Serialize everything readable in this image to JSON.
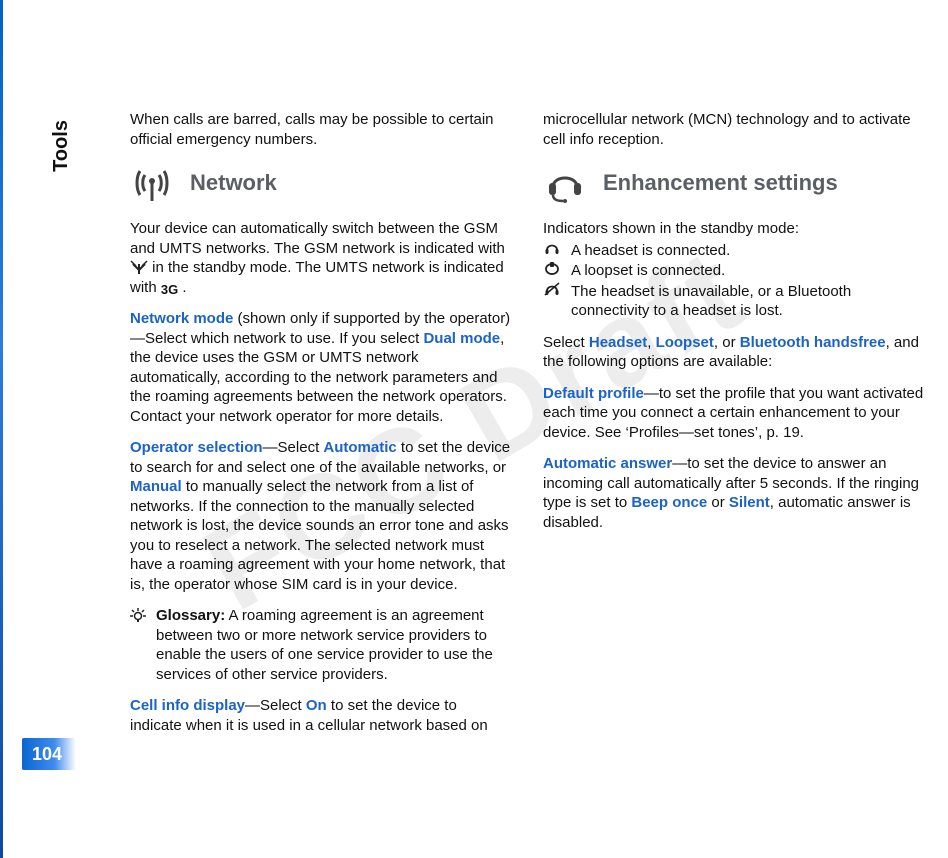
{
  "page": {
    "sectionTitle": "Tools",
    "number": "104",
    "watermark": "FCC Draft"
  },
  "col1": {
    "intro": "When calls are barred, calls may be possible to certain official emergency numbers.",
    "h_network": "Network",
    "network_body": "Your device can automatically switch between the GSM and UMTS networks. The GSM network is indicated with ",
    "network_body2": " in the standby mode. The UMTS network is indicated with ",
    "network_body3": ".",
    "nm_label": "Network mode",
    "nm_body1": " (shown only if supported by the operator)—Select which network to use. If you select ",
    "nm_dual": "Dual mode",
    "nm_body2": ", the device uses the GSM or UMTS network automatically, according to the network parameters and the roaming agreements between the network operators. Contact your network operator for more details.",
    "os_label": "Operator selection",
    "os_body1": "—Select ",
    "os_auto": "Automatic",
    "os_body2": " to set the device to search for and select one of the available networks, or ",
    "os_manual": "Manual",
    "os_body3": " to manually select the network from a list of networks. If the connection to the manually selected network is lost, the device sounds an error tone and asks you to reselect a network. The selected network must have a roaming agreement with your home network, that is, the operator whose SIM card is in your device.",
    "gloss_label": "Glossary:",
    "gloss_body": " A roaming agreement is an agreement between two or more network service providers to enable the users of one service provider to use the services of other service providers."
  },
  "col2": {
    "cid_label": "Cell info display",
    "cid_body1": "—Select ",
    "cid_on": "On",
    "cid_body2": " to set the device to indicate when it is used in a cellular network based on microcellular network (MCN) technology and to activate cell info reception.",
    "h_enh": "Enhancement settings",
    "ind_intro": "Indicators shown in the standby mode:",
    "ind_hs": " A headset is connected.",
    "ind_lp": " A loopset is connected.",
    "ind_bt": " The headset is unavailable, or a Bluetooth connectivity to a headset is lost.",
    "sel_body1": "Select ",
    "sel_hs": "Headset",
    "sel_body2": ", ",
    "sel_lp": "Loopset",
    "sel_body3": ", or ",
    "sel_bt": "Bluetooth handsfree",
    "sel_body4": ", and the following options are available:",
    "dp_label": "Default profile",
    "dp_body": "—to set the profile that you want activated each time you connect a certain enhancement to your device. See ‘Profiles—set tones’, p. 19.",
    "aa_label": "Automatic answer",
    "aa_body1": "—to set the device to answer an incoming call automatically after 5 seconds. If the ringing type is set to ",
    "aa_beep": "Beep once",
    "aa_body2": " or ",
    "aa_silent": "Silent",
    "aa_body3": ", automatic answer is disabled."
  },
  "icons": {
    "antenna": "antenna-icon",
    "signal": "signal-icon",
    "threeG": "3G",
    "bulb": "bulb-icon",
    "headset": "headset-icon",
    "headphones": "headphones-icon",
    "loopset": "loopset-icon",
    "headphones_strike": "headphones-strike-icon"
  }
}
